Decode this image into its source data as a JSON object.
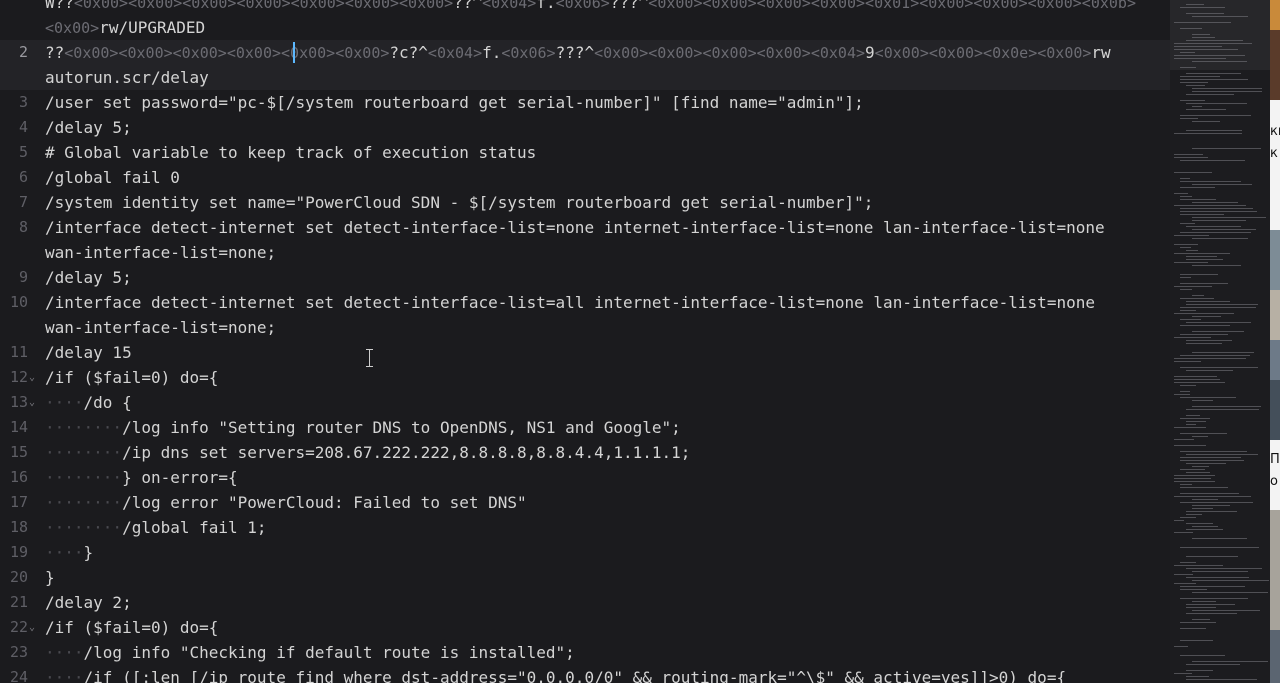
{
  "editor": {
    "lines": [
      {
        "n": "",
        "fold": false,
        "current": false,
        "segs": [
          [
            "t",
            "W??"
          ],
          [
            "c",
            "<0x00>"
          ],
          [
            "c",
            "<0x00>"
          ],
          [
            "c",
            "<0x00>"
          ],
          [
            "c",
            "<0x00>"
          ],
          [
            "c",
            "<0x00>"
          ],
          [
            "c",
            "<0x00>"
          ],
          [
            "c",
            "<0x00>"
          ],
          [
            "t",
            "??^"
          ],
          [
            "c",
            "<0x04>"
          ],
          [
            "t",
            "f."
          ],
          [
            "c",
            "<0x06>"
          ],
          [
            "t",
            "???^"
          ],
          [
            "c",
            "<0x00>"
          ],
          [
            "c",
            "<0x00>"
          ],
          [
            "c",
            "<0x00>"
          ],
          [
            "c",
            "<0x00>"
          ],
          [
            "c",
            "<0x01>"
          ],
          [
            "c",
            "<0x00>"
          ],
          [
            "c",
            "<0x00>"
          ],
          [
            "c",
            "<0x00>"
          ],
          [
            "c",
            "<0x0b>"
          ]
        ]
      },
      {
        "n": "",
        "fold": false,
        "current": false,
        "segs": [
          [
            "c",
            "<0x00>"
          ],
          [
            "t",
            "rw/UPGRADED"
          ]
        ]
      },
      {
        "n": "2",
        "fold": false,
        "current": true,
        "segs": [
          [
            "t",
            "??"
          ],
          [
            "c",
            "<0x00>"
          ],
          [
            "c",
            "<0x00>"
          ],
          [
            "c",
            "<0x00>"
          ],
          [
            "c",
            "<0x00>"
          ],
          [
            "c",
            "<0x00>"
          ],
          [
            "c",
            "<0x00>"
          ],
          [
            "t",
            "?c?^"
          ],
          [
            "c",
            "<0x04>"
          ],
          [
            "t",
            "f."
          ],
          [
            "c",
            "<0x06>"
          ],
          [
            "t",
            "???^"
          ],
          [
            "c",
            "<0x00>"
          ],
          [
            "c",
            "<0x00>"
          ],
          [
            "c",
            "<0x00>"
          ],
          [
            "c",
            "<0x00>"
          ],
          [
            "c",
            "<0x04>"
          ],
          [
            "t",
            "9"
          ],
          [
            "c",
            "<0x00>"
          ],
          [
            "c",
            "<0x00>"
          ],
          [
            "c",
            "<0x0e>"
          ],
          [
            "c",
            "<0x00>"
          ],
          [
            "t",
            "rw"
          ]
        ]
      },
      {
        "n": "",
        "fold": false,
        "current": true,
        "segs": [
          [
            "t",
            "autorun.scr/delay"
          ]
        ]
      },
      {
        "n": "3",
        "fold": false,
        "current": false,
        "segs": [
          [
            "t",
            "/user set password=\"pc-$[/system routerboard get serial-number]\" [find name=\"admin\"];"
          ]
        ]
      },
      {
        "n": "4",
        "fold": false,
        "current": false,
        "segs": [
          [
            "t",
            "/delay 5;"
          ]
        ]
      },
      {
        "n": "5",
        "fold": false,
        "current": false,
        "segs": [
          [
            "t",
            "# Global variable to keep track of execution status"
          ]
        ]
      },
      {
        "n": "6",
        "fold": false,
        "current": false,
        "segs": [
          [
            "t",
            "/global fail 0"
          ]
        ]
      },
      {
        "n": "7",
        "fold": false,
        "current": false,
        "segs": [
          [
            "t",
            "/system identity set name=\"PowerCloud SDN - $[/system routerboard get serial-number]\";"
          ]
        ]
      },
      {
        "n": "8",
        "fold": false,
        "current": false,
        "segs": [
          [
            "t",
            "/interface detect-internet set detect-interface-list=none internet-interface-list=none lan-interface-list=none"
          ]
        ]
      },
      {
        "n": "",
        "fold": false,
        "current": false,
        "segs": [
          [
            "t",
            "wan-interface-list=none;"
          ]
        ]
      },
      {
        "n": "9",
        "fold": false,
        "current": false,
        "segs": [
          [
            "t",
            "/delay 5;"
          ]
        ]
      },
      {
        "n": "10",
        "fold": false,
        "current": false,
        "segs": [
          [
            "t",
            "/interface detect-internet set detect-interface-list=all internet-interface-list=none lan-interface-list=none"
          ]
        ]
      },
      {
        "n": "",
        "fold": false,
        "current": false,
        "segs": [
          [
            "t",
            "wan-interface-list=none;"
          ]
        ]
      },
      {
        "n": "11",
        "fold": false,
        "current": false,
        "segs": [
          [
            "t",
            "/delay 15"
          ]
        ]
      },
      {
        "n": "12",
        "fold": true,
        "current": false,
        "segs": [
          [
            "t",
            "/if ($fail=0) do={"
          ]
        ]
      },
      {
        "n": "13",
        "fold": true,
        "current": false,
        "segs": [
          [
            "w",
            "····"
          ],
          [
            "t",
            "/do {"
          ]
        ]
      },
      {
        "n": "14",
        "fold": false,
        "current": false,
        "segs": [
          [
            "w",
            "········"
          ],
          [
            "t",
            "/log info \"Setting router DNS to OpenDNS, NS1 and Google\";"
          ]
        ]
      },
      {
        "n": "15",
        "fold": false,
        "current": false,
        "segs": [
          [
            "w",
            "········"
          ],
          [
            "t",
            "/ip dns set servers=208.67.222.222,8.8.8.8,8.8.4.4,1.1.1.1;"
          ]
        ]
      },
      {
        "n": "16",
        "fold": false,
        "current": false,
        "segs": [
          [
            "w",
            "········"
          ],
          [
            "t",
            "} on-error={"
          ]
        ]
      },
      {
        "n": "17",
        "fold": false,
        "current": false,
        "segs": [
          [
            "w",
            "········"
          ],
          [
            "t",
            "/log error \"PowerCloud: Failed to set DNS\""
          ]
        ]
      },
      {
        "n": "18",
        "fold": false,
        "current": false,
        "segs": [
          [
            "w",
            "········"
          ],
          [
            "t",
            "/global fail 1;"
          ]
        ]
      },
      {
        "n": "19",
        "fold": false,
        "current": false,
        "segs": [
          [
            "w",
            "····"
          ],
          [
            "t",
            "}"
          ]
        ]
      },
      {
        "n": "20",
        "fold": false,
        "current": false,
        "segs": [
          [
            "t",
            "}"
          ]
        ]
      },
      {
        "n": "21",
        "fold": false,
        "current": false,
        "segs": [
          [
            "t",
            "/delay 2;"
          ]
        ]
      },
      {
        "n": "22",
        "fold": true,
        "current": false,
        "segs": [
          [
            "t",
            "/if ($fail=0) do={"
          ]
        ]
      },
      {
        "n": "23",
        "fold": false,
        "current": false,
        "segs": [
          [
            "w",
            "····"
          ],
          [
            "t",
            "/log info \"Checking if default route is installed\";"
          ]
        ]
      },
      {
        "n": "24",
        "fold": false,
        "current": false,
        "segs": [
          [
            "w",
            "····"
          ],
          [
            "t",
            "/if ([:len [/ip route find where dst-address=\"0.0.0.0/0\" && routing-mark=\"^\\$\" && active=yes]]>0) do={"
          ]
        ]
      }
    ],
    "fold_glyph": "⌄"
  },
  "colors": {
    "editor_bg": "#1b1b1e",
    "current_line_bg": "#232327",
    "text": "#d4d4d4",
    "control_chars": "#6c6c73",
    "whitespace_dots": "#4a4a50",
    "cursor": "#5cb8ff"
  },
  "right_edge_fragments": [
    "ки",
    "к",
    "Пр",
    "о"
  ]
}
